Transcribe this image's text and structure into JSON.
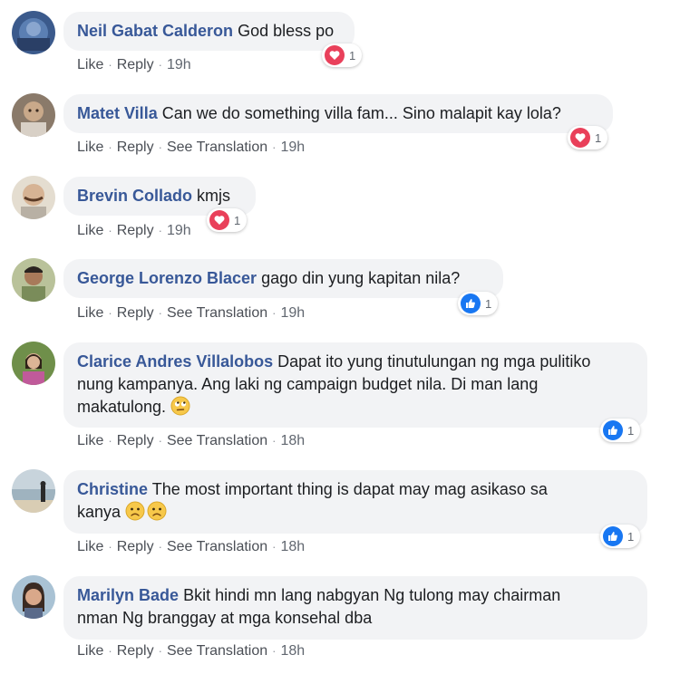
{
  "comments": [
    {
      "author": "Neil Gabat Calderon",
      "text": "God bless po",
      "like": "Like",
      "reply": "Reply",
      "time": "19h",
      "reaction_count": "1"
    },
    {
      "author": "Matet Villa",
      "text": "Can we do something villa fam... Sino malapit kay lola?",
      "like": "Like",
      "reply": "Reply",
      "translate": "See Translation",
      "time": "19h",
      "reaction_count": "1"
    },
    {
      "author": "Brevin Collado",
      "text": "kmjs",
      "like": "Like",
      "reply": "Reply",
      "time": "19h",
      "reaction_count": "1"
    },
    {
      "author": "George Lorenzo Blacer",
      "text": "gago din yung kapitan nila?",
      "like": "Like",
      "reply": "Reply",
      "translate": "See Translation",
      "time": "19h",
      "reaction_count": "1"
    },
    {
      "author": "Clarice Andres Villalobos",
      "line1": "Dapat ito yung tinutulungan ng mga pulitiko",
      "line2": "nung kampanya. Ang laki ng campaign budget nila. Di man lang",
      "line3": "makatulong.",
      "like": "Like",
      "reply": "Reply",
      "translate": "See Translation",
      "time": "18h",
      "reaction_count": "1"
    },
    {
      "author": "Christine",
      "line1": "The most important thing is dapat may mag asikaso sa",
      "line2": "kanya",
      "like": "Like",
      "reply": "Reply",
      "translate": "See Translation",
      "time": "18h",
      "reaction_count": "1"
    },
    {
      "author": "Marilyn Bade",
      "line1": "Bkit hindi mn lang nabgyan Ng tulong may chairman",
      "line2": "nman Ng branggay at mga konsehal dba",
      "like": "Like",
      "reply": "Reply",
      "translate": "See Translation",
      "time": "18h"
    }
  ],
  "colors": {
    "author": "#385898",
    "bubble": "#f2f3f5",
    "love": "#e9405a",
    "like": "#1877f2"
  },
  "icons": {
    "love": "heart-icon",
    "like": "thumbs-up-icon",
    "eye_roll": "face-with-rolling-eyes-icon",
    "frown": "frowning-face-icon"
  }
}
